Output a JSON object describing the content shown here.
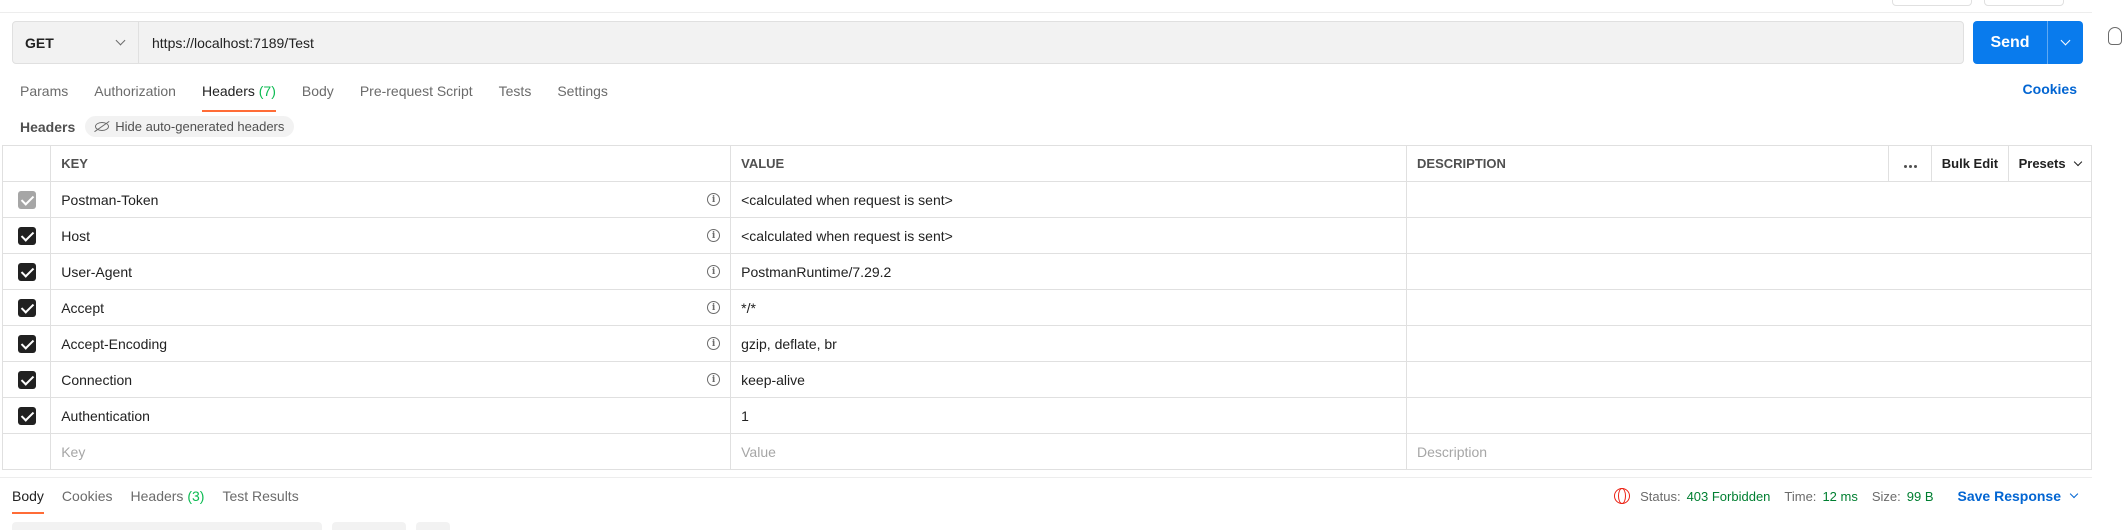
{
  "request": {
    "method": "GET",
    "url": "https://localhost:7189/Test",
    "send_label": "Send"
  },
  "req_tabs": [
    {
      "label": "Params",
      "count": ""
    },
    {
      "label": "Authorization",
      "count": ""
    },
    {
      "label": "Headers",
      "count": "(7)"
    },
    {
      "label": "Body",
      "count": ""
    },
    {
      "label": "Pre-request Script",
      "count": ""
    },
    {
      "label": "Tests",
      "count": ""
    },
    {
      "label": "Settings",
      "count": ""
    }
  ],
  "cookies_label": "Cookies",
  "headers_section": {
    "title": "Headers",
    "hide_button": "Hide auto-generated headers"
  },
  "table": {
    "columns": {
      "key": "KEY",
      "value": "VALUE",
      "description": "DESCRIPTION"
    },
    "bulk_edit": "Bulk Edit",
    "presets": "Presets",
    "rows": [
      {
        "key": "Postman-Token",
        "value": "<calculated when request is sent>",
        "description": ""
      },
      {
        "key": "Host",
        "value": "<calculated when request is sent>",
        "description": ""
      },
      {
        "key": "User-Agent",
        "value": "PostmanRuntime/7.29.2",
        "description": ""
      },
      {
        "key": "Accept",
        "value": "*/*",
        "description": ""
      },
      {
        "key": "Accept-Encoding",
        "value": "gzip, deflate, br",
        "description": ""
      },
      {
        "key": "Connection",
        "value": "keep-alive",
        "description": ""
      },
      {
        "key": "Authentication",
        "value": "1",
        "description": ""
      }
    ],
    "placeholders": {
      "key": "Key",
      "value": "Value",
      "description": "Description"
    }
  },
  "res_tabs": [
    {
      "label": "Body",
      "count": ""
    },
    {
      "label": "Cookies",
      "count": ""
    },
    {
      "label": "Headers",
      "count": "(3)"
    },
    {
      "label": "Test Results",
      "count": ""
    }
  ],
  "response": {
    "status_label": "Status:",
    "status_value": "403 Forbidden",
    "time_label": "Time:",
    "time_value": "12 ms",
    "size_label": "Size:",
    "size_value": "99 B",
    "save_label": "Save Response"
  },
  "colors": {
    "accent": "#ff6c37",
    "send": "#097bed",
    "link": "#0265d2",
    "success": "#007f31",
    "error": "#eb2013"
  }
}
